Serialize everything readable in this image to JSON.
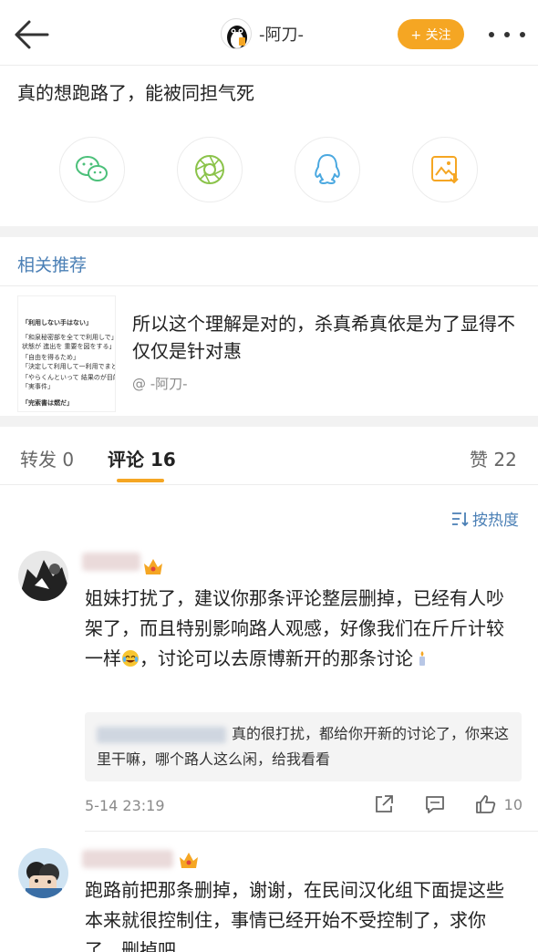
{
  "header": {
    "username": "-阿刀-",
    "follow_label": "+ 关注",
    "icons": [
      "back-arrow-icon",
      "penguin-avatar",
      "more-dots-icon"
    ]
  },
  "post": {
    "text": "真的想跑路了，能被同担气死"
  },
  "share": {
    "icons": [
      "wechat-icon",
      "moments-icon",
      "qq-icon",
      "save-image-icon"
    ],
    "colors": {
      "wechat": "#4cc07a",
      "moments": "#8bc34a",
      "qq": "#4aa8e0",
      "save": "#f5a623"
    }
  },
  "related": {
    "title": "相关推荐",
    "thumb_lines": [
      "「利用しない手はない」",
      "「和泉秘密部を全てで利用しで」",
      "状態が 進出を 重要を図をする」",
      "「自由を得るため」",
      "「決定して利用して一利用でまとまる」",
      "「やらくんといって 結果のが目的」",
      "「実事件」",
      "「完索書は燃だ」"
    ],
    "body": "所以这个理解是对的，杀真希真依是为了显得不仅仅是针对惠",
    "author": "@ -阿刀-"
  },
  "tabs": {
    "repost": "转发 0",
    "comment": "评论 16",
    "like": "赞 22"
  },
  "sort_label": "按热度",
  "comments": [
    {
      "text_before": "姐妹打扰了，建议你那条评论整层删掉，已经有人吵架了，而且特别影响路人观感，好像我们在斤斤计较一样",
      "text_middle": "，讨论可以去原博新开的那条讨论",
      "reply": "真的很打扰，都给你开新的讨论了，你来这里干嘛，哪个路人这么闲，给我看看",
      "time": "5-14 23:19",
      "likes": "10"
    },
    {
      "text": "跑路前把那条删掉，谢谢，在民间汉化组下面提这些本来就很控制住，事情已经开始不受控制了，求你了，删掉吧"
    }
  ]
}
